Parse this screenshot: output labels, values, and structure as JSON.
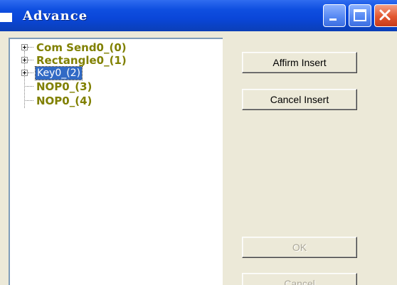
{
  "window": {
    "title": "Advance"
  },
  "tree": {
    "items": [
      {
        "label": "Com Send0_(0)",
        "expandable": true,
        "selected": false
      },
      {
        "label": "Rectangle0_(1)",
        "expandable": true,
        "selected": false
      },
      {
        "label": "Key0_(2)",
        "expandable": true,
        "selected": true
      },
      {
        "label": "NOP0_(3)",
        "expandable": false,
        "selected": false
      },
      {
        "label": "NOP0_(4)",
        "expandable": false,
        "selected": false
      }
    ]
  },
  "buttons": {
    "affirm_insert": "Affirm Insert",
    "cancel_insert": "Cancel Insert",
    "ok": "OK",
    "cancel": "Cancel"
  },
  "colors": {
    "titlebar": "#0a46d8",
    "tree_text": "#808000",
    "selection": "#316ac5",
    "disabled_text": "#aca899"
  },
  "icons": {
    "minimize": "minimize-icon",
    "maximize": "maximize-icon",
    "close": "close-icon",
    "expander": "plus-box-icon"
  }
}
